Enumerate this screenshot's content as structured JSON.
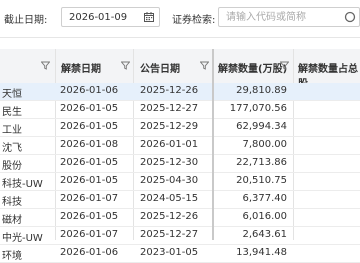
{
  "toolbar": {
    "date_label": "截止日期:",
    "date_value": "2026-01-09",
    "search_label": "证券检索:",
    "search_placeholder": "请输入代码或简称"
  },
  "table": {
    "columns": [
      "解禁日期",
      "公告日期",
      "解禁数量(万股)",
      "解禁数量占总股"
    ],
    "rows": [
      {
        "name": "天恒",
        "unlock_date": "2026-01-06",
        "announce_date": "2025-12-26",
        "quantity": "29,810.89"
      },
      {
        "name": "民生",
        "unlock_date": "2026-01-05",
        "announce_date": "2025-12-27",
        "quantity": "177,070.56"
      },
      {
        "name": "工业",
        "unlock_date": "2026-01-05",
        "announce_date": "2025-12-29",
        "quantity": "62,994.34"
      },
      {
        "name": "沈飞",
        "unlock_date": "2026-01-08",
        "announce_date": "2026-01-01",
        "quantity": "7,800.00"
      },
      {
        "name": "股份",
        "unlock_date": "2026-01-05",
        "announce_date": "2025-12-30",
        "quantity": "22,713.86"
      },
      {
        "name": "科技-UW",
        "unlock_date": "2026-01-05",
        "announce_date": "2025-04-30",
        "quantity": "20,510.75"
      },
      {
        "name": "科技",
        "unlock_date": "2026-01-07",
        "announce_date": "2024-05-15",
        "quantity": "6,377.40"
      },
      {
        "name": "磁材",
        "unlock_date": "2026-01-05",
        "announce_date": "2025-12-26",
        "quantity": "6,016.00"
      },
      {
        "name": "中光-UW",
        "unlock_date": "2026-01-07",
        "announce_date": "2025-12-27",
        "quantity": "2,643.61"
      },
      {
        "name": "环境",
        "unlock_date": "2026-01-06",
        "announce_date": "2023-01-05",
        "quantity": "13,941.48"
      }
    ]
  }
}
